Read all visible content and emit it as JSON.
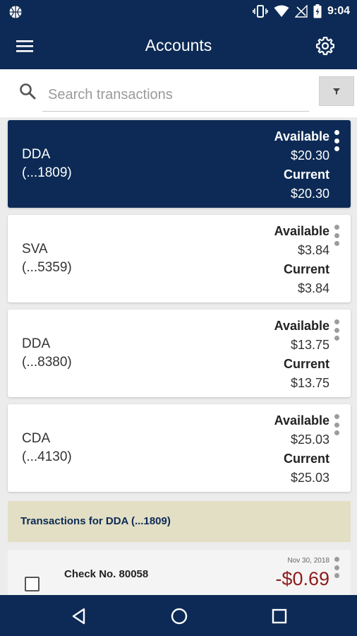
{
  "status_bar": {
    "time": "9:04",
    "icons": [
      "basketball-icon",
      "vibrate-icon",
      "wifi-icon",
      "no-signal-icon",
      "battery-icon"
    ]
  },
  "app_bar": {
    "title": "Accounts",
    "menu_icon": "hamburger-menu-icon",
    "settings_icon": "gear-icon"
  },
  "search": {
    "placeholder": "Search transactions",
    "value": "",
    "filter_icon": "filter-icon"
  },
  "accounts": [
    {
      "name": "DDA",
      "number": "(...1809)",
      "available_label": "Available",
      "available": "$20.30",
      "current_label": "Current",
      "current": "$20.30",
      "selected": true
    },
    {
      "name": "SVA",
      "number": "(...5359)",
      "available_label": "Available",
      "available": "$3.84",
      "current_label": "Current",
      "current": "$3.84",
      "selected": false
    },
    {
      "name": "DDA",
      "number": "(...8380)",
      "available_label": "Available",
      "available": "$13.75",
      "current_label": "Current",
      "current": "$13.75",
      "selected": false
    },
    {
      "name": "CDA",
      "number": "(...4130)",
      "available_label": "Available",
      "available": "$25.03",
      "current_label": "Current",
      "current": "$25.03",
      "selected": false
    }
  ],
  "transactions_header": "Transactions for DDA (...1809)",
  "transactions": [
    {
      "description": "Check No. 80058",
      "date": "Nov 30, 2018",
      "amount": "-$0.69"
    }
  ],
  "nav": [
    "back-icon",
    "home-icon",
    "recents-icon"
  ],
  "colors": {
    "primary": "#0c2a55",
    "header_band": "#e3dfc4",
    "debit": "#8e1c1c"
  }
}
